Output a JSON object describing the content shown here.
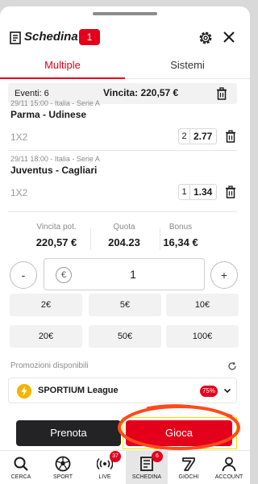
{
  "header": {
    "title": "Schedina",
    "count": "1"
  },
  "tabs": [
    {
      "label": "Multiple"
    },
    {
      "label": "Sistemi"
    }
  ],
  "summary": {
    "events": "Eventi: 6",
    "win": "Vincita:  220,57 €"
  },
  "bets": [
    {
      "meta": "29/11 15:00 - Italia - Serie A",
      "match": "Parma - Udinese",
      "market": "1X2",
      "selection": "2",
      "odd": "2.77"
    },
    {
      "meta": "29/11 18:00 - Italia - Serie A",
      "match": "Juventus - Cagliari",
      "market": "1X2",
      "selection": "1",
      "odd": "1.34"
    }
  ],
  "stats": {
    "win_label": "Vincita pot.",
    "win_value": "220,57 €",
    "odds_label": "Quota",
    "odds_value": "204.23",
    "bonus_label": "Bonus",
    "bonus_value": "16,34 €"
  },
  "stake": {
    "minus": "-",
    "plus": "+",
    "currency": "€",
    "amount": "1"
  },
  "quick_stakes": [
    "2€",
    "5€",
    "10€",
    "20€",
    "50€",
    "100€"
  ],
  "promo": {
    "title": "Promozioni disponibili",
    "name": "SPORTIUM League",
    "percent": "75%"
  },
  "actions": {
    "book": "Prenota",
    "play": "Gioca"
  },
  "nav": [
    {
      "label": "CERCA",
      "icon": "search-icon"
    },
    {
      "label": "SPORT",
      "icon": "soccer-ball-icon"
    },
    {
      "label": "LIVE",
      "icon": "live-broadcast-icon",
      "badge": "37"
    },
    {
      "label": "SCHEDINA",
      "icon": "betslip-icon",
      "badge": "6"
    },
    {
      "label": "GIOCHI",
      "icon": "seven-icon"
    },
    {
      "label": "ACCOUNT",
      "icon": "user-icon"
    }
  ],
  "colors": {
    "accent": "#e4001b",
    "dark_button": "#232326",
    "promo_icon": "#f5b400",
    "annotation": "#ff4a1c",
    "highlight": "#f2e200"
  }
}
